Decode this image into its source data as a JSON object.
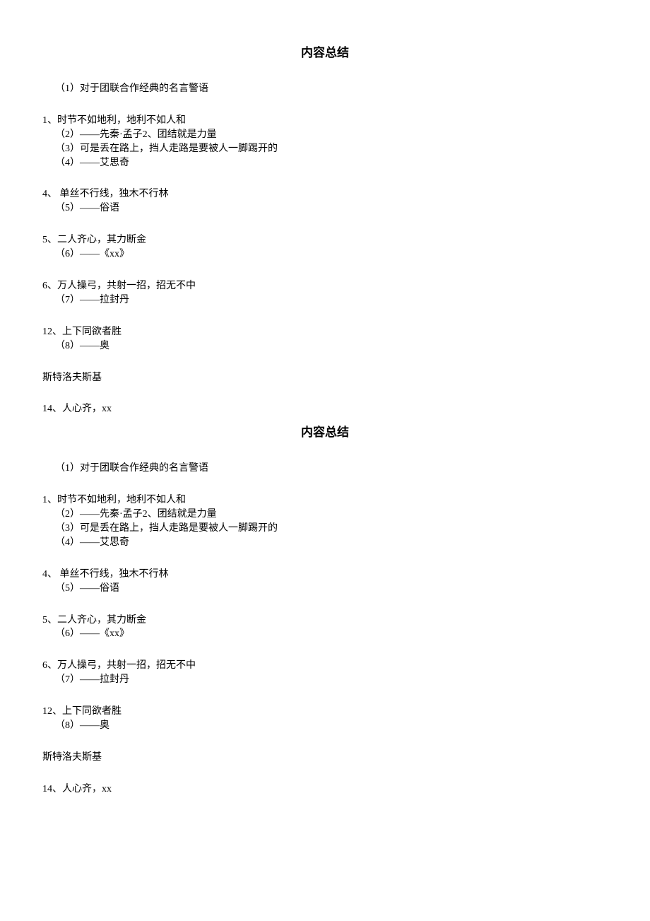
{
  "sections": [
    {
      "title": "内容总结",
      "intro": "（1）对于团联合作经典的名言警语",
      "groups": [
        {
          "head": "1、时节不如地利，地利不如人和",
          "subs": [
            "（2）——先秦·孟子2、团结就是力量",
            "（3）可是丢在路上，挡人走路是要被人一脚踢开的",
            "（4）——艾思奇"
          ]
        },
        {
          "head": "4、 单丝不行线，独木不行林",
          "subs": [
            "（5）——俗语"
          ]
        },
        {
          "head": "5、二人齐心，其力断金",
          "subs": [
            "（6）——《xx》"
          ]
        },
        {
          "head": "6、万人操弓，共射一招，招无不中",
          "subs": [
            "（7）——拉封丹"
          ]
        },
        {
          "head": "12、上下同欲者胜",
          "subs": [
            "（8）——奥"
          ]
        }
      ],
      "tail1": "斯特洛夫斯基",
      "tail2": "14、人心齐，xx"
    },
    {
      "title": "内容总结",
      "intro": "（1）对于团联合作经典的名言警语",
      "groups": [
        {
          "head": "1、时节不如地利，地利不如人和",
          "subs": [
            "（2）——先秦·孟子2、团结就是力量",
            "（3）可是丢在路上，挡人走路是要被人一脚踢开的",
            "（4）——艾思奇"
          ]
        },
        {
          "head": "4、 单丝不行线，独木不行林",
          "subs": [
            "（5）——俗语"
          ]
        },
        {
          "head": "5、二人齐心，其力断金",
          "subs": [
            "（6）——《xx》"
          ]
        },
        {
          "head": "6、万人操弓，共射一招，招无不中",
          "subs": [
            "（7）——拉封丹"
          ]
        },
        {
          "head": "12、上下同欲者胜",
          "subs": [
            "（8）——奥"
          ]
        }
      ],
      "tail1": "斯特洛夫斯基",
      "tail2": "14、人心齐，xx"
    }
  ]
}
